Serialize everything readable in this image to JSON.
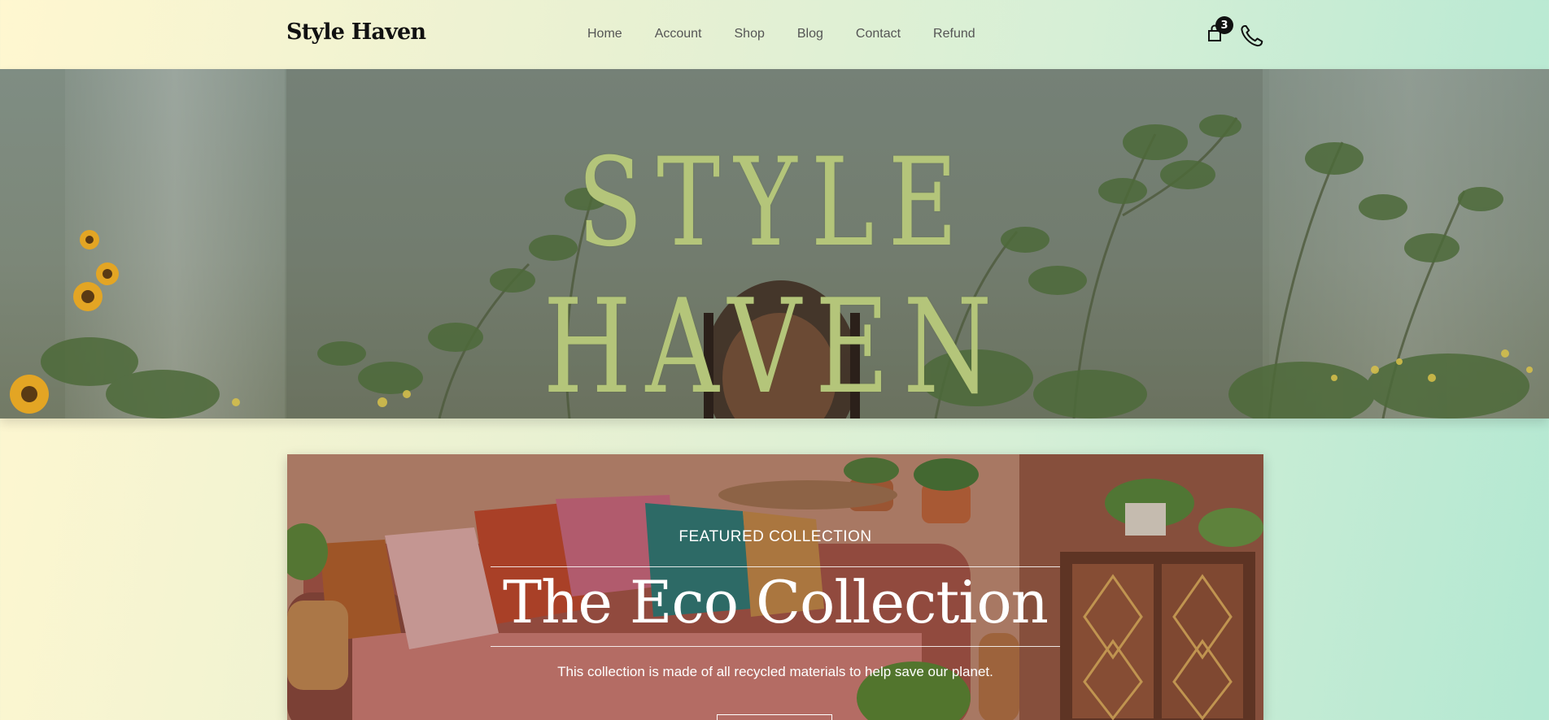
{
  "header": {
    "logo": "Style Haven",
    "nav": [
      {
        "label": "Home"
      },
      {
        "label": "Account"
      },
      {
        "label": "Shop"
      },
      {
        "label": "Blog"
      },
      {
        "label": "Contact"
      },
      {
        "label": "Refund"
      }
    ],
    "cart_count": "3",
    "icons": {
      "cart": "shopping-bag-icon",
      "phone": "phone-icon"
    }
  },
  "hero": {
    "line1": "STYLE",
    "line2": "HAVEN",
    "text_color": "#b4c57a"
  },
  "featured": {
    "kicker": "FEATURED COLLECTION",
    "title": "The Eco Collection",
    "description": "This collection is made of all recycled materials to help save our planet.",
    "button_label": ""
  },
  "colors": {
    "background_start": "#fff7d0",
    "background_end": "#b3e8d2",
    "text_dark": "#111111",
    "nav_text": "#555555"
  }
}
